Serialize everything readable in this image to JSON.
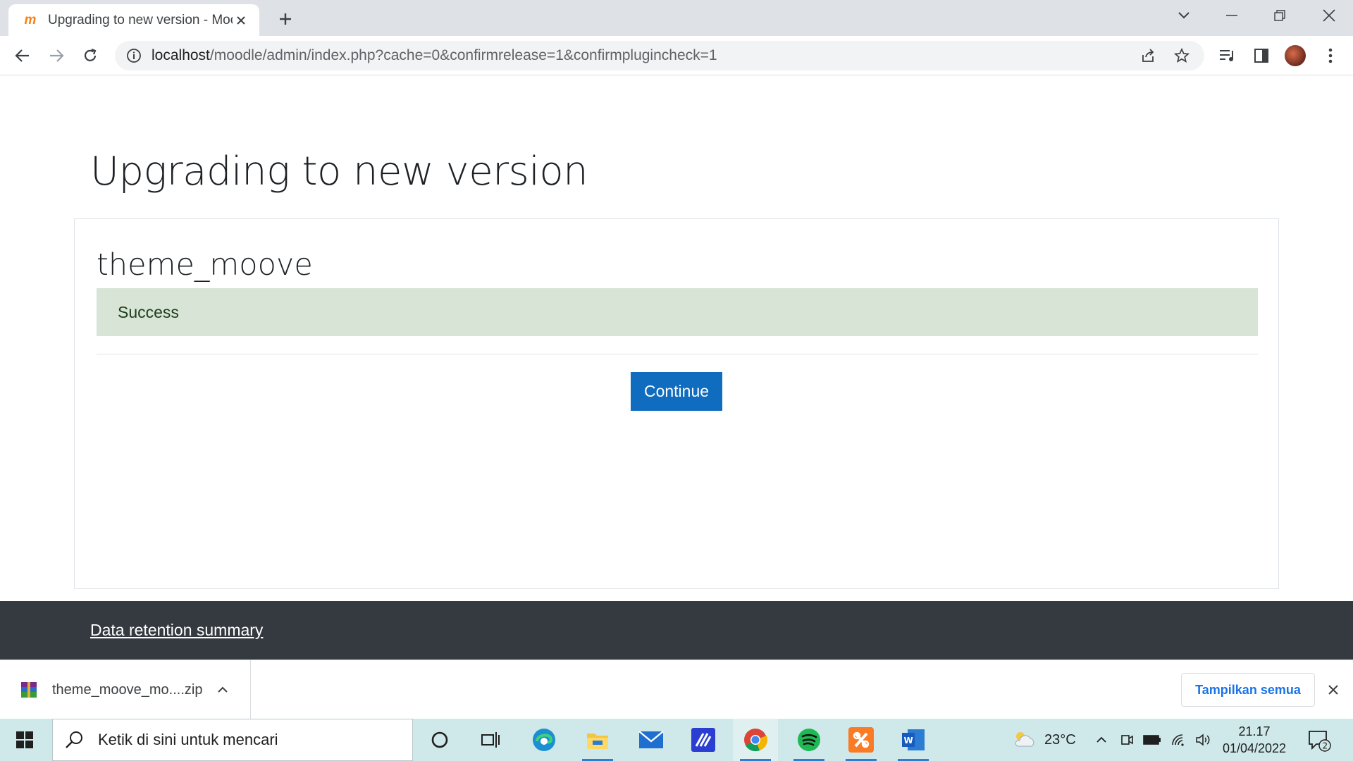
{
  "browser": {
    "tab_title": "Upgrading to new version - Moo",
    "url_host": "localhost",
    "url_rest": "/moodle/admin/index.php?cache=0&confirmrelease=1&confirmplugincheck=1"
  },
  "page": {
    "heading": "Upgrading to new version",
    "plugin_name": "theme_moove",
    "status_message": "Success",
    "continue_label": "Continue"
  },
  "footer": {
    "link_label": "Data retention summary"
  },
  "download_bar": {
    "file_name": "theme_moove_mo....zip",
    "show_all_label": "Tampilkan semua"
  },
  "taskbar": {
    "search_placeholder": "Ketik di sini untuk mencari",
    "temperature": "23°C",
    "time": "21.17",
    "date": "01/04/2022",
    "notification_count": "2"
  },
  "colors": {
    "primary": "#0f6cbf",
    "success_bg": "#d7e4d6",
    "footer_bg": "#343a40",
    "taskbar_bg": "#cfe8e9"
  }
}
